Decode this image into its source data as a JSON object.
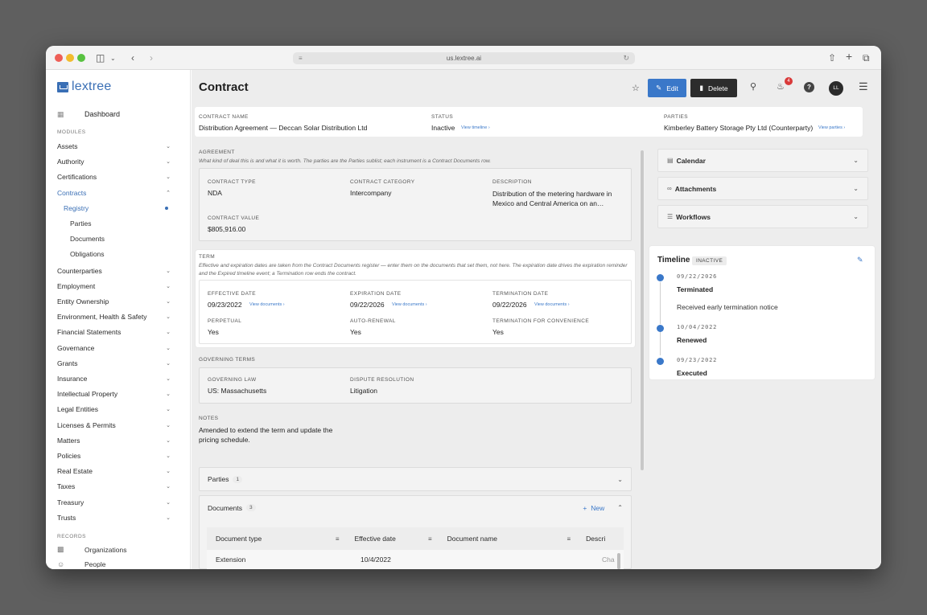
{
  "browser": {
    "url": "us.lextree.ai"
  },
  "sidebar": {
    "logo": "lextree",
    "dashboard": "Dashboard",
    "modules_label": "MODULES",
    "modules": [
      "Assets",
      "Authority",
      "Certifications",
      "Contracts"
    ],
    "contracts_sub": [
      "Registry",
      "Parties",
      "Documents",
      "Obligations"
    ],
    "modules_rest": [
      "Counterparties",
      "Employment",
      "Entity Ownership",
      "Environment, Health & Safety",
      "Financial Statements",
      "Governance",
      "Grants",
      "Insurance",
      "Intellectual Property",
      "Legal Entities",
      "Licenses & Permits",
      "Matters",
      "Policies",
      "Real Estate",
      "Taxes",
      "Treasury",
      "Trusts"
    ],
    "records_label": "RECORDS",
    "records": [
      "Organizations",
      "People"
    ]
  },
  "header": {
    "title": "Contract",
    "edit": "Edit",
    "delete": "Delete",
    "notifications": "4",
    "avatar": "LL"
  },
  "summary": {
    "name_label": "CONTRACT NAME",
    "name": "Distribution Agreement — Deccan Solar Distribution Ltd",
    "status_label": "STATUS",
    "status": "Inactive",
    "status_link": "View timeline ›",
    "parties_label": "PARTIES",
    "parties": "Kimberley Battery Storage Pty Ltd (Counterparty)",
    "parties_link": "View parties ›"
  },
  "agreement": {
    "heading": "AGREEMENT",
    "desc": "What kind of deal this is and what it is worth. The parties are the Parties sublist; each instrument is a Contract Documents row.",
    "type_label": "CONTRACT TYPE",
    "type": "NDA",
    "category_label": "CONTRACT CATEGORY",
    "category": "Intercompany",
    "description_label": "DESCRIPTION",
    "description": "Distribution of the metering hardware in Mexico and Central America on an…",
    "value_label": "CONTRACT VALUE",
    "value": "$805,916.00"
  },
  "term": {
    "heading": "TERM",
    "desc": "Effective and expiration dates are taken from the Contract Documents register — enter them on the documents that set them, not here. The expiration date drives the expiration reminder and the Expired timeline event; a Termination row ends the contract.",
    "effective_label": "EFFECTIVE DATE",
    "effective": "09/23/2022",
    "expiration_label": "EXPIRATION DATE",
    "expiration": "09/22/2026",
    "termination_label": "TERMINATION DATE",
    "termination": "09/22/2026",
    "view_documents": "View documents ›",
    "perpetual_label": "PERPETUAL",
    "perpetual": "Yes",
    "autorenew_label": "AUTO-RENEWAL",
    "autorenew": "Yes",
    "convenience_label": "TERMINATION FOR CONVENIENCE",
    "convenience": "Yes"
  },
  "governing": {
    "heading": "GOVERNING TERMS",
    "law_label": "GOVERNING LAW",
    "law": "US: Massachusetts",
    "dispute_label": "DISPUTE RESOLUTION",
    "dispute": "Litigation"
  },
  "notes": {
    "heading": "NOTES",
    "text": "Amended to extend the term and update the pricing schedule."
  },
  "parties_acc": {
    "label": "Parties",
    "count": "1"
  },
  "documents_acc": {
    "label": "Documents",
    "count": "3",
    "new": "New"
  },
  "documents_table": {
    "columns": [
      "Document type",
      "Effective date",
      "Document name",
      "Descri"
    ],
    "rows": [
      [
        "Extension",
        "10/4/2022",
        "",
        "Cha"
      ]
    ]
  },
  "right_panels": [
    "Calendar",
    "Attachments",
    "Workflows"
  ],
  "timeline": {
    "title": "Timeline",
    "badge": "INACTIVE",
    "events": [
      {
        "date": "09/22/2026",
        "title": "Terminated",
        "note": "Received early termination notice"
      },
      {
        "date": "10/04/2022",
        "title": "Renewed",
        "note": ""
      },
      {
        "date": "09/23/2022",
        "title": "Executed",
        "note": ""
      }
    ]
  },
  "colors": {
    "accent": "#3a78c9",
    "brand": "#3a6fb5",
    "dark_button": "#2c2c2c",
    "badge_red": "#d93a3a"
  }
}
